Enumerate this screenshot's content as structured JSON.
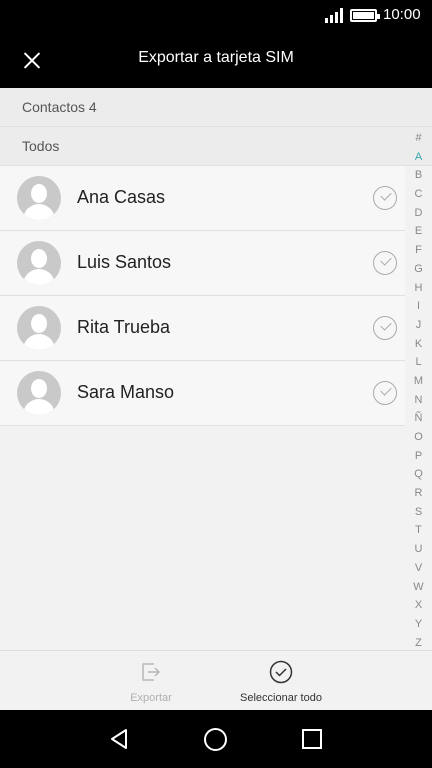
{
  "status_bar": {
    "time": "10:00",
    "icons": [
      "signal-icon",
      "battery-icon"
    ]
  },
  "toolbar": {
    "title": "Exportar a tarjeta SIM",
    "close_icon": "close-icon"
  },
  "header_count": "Contactos 4",
  "header_group": "Todos",
  "contacts": [
    {
      "name": "Ana Casas"
    },
    {
      "name": "Luis Santos"
    },
    {
      "name": "Rita Trueba"
    },
    {
      "name": "Sara Manso"
    }
  ],
  "alphabet": [
    "#",
    "A",
    "B",
    "C",
    "D",
    "E",
    "F",
    "G",
    "H",
    "I",
    "J",
    "K",
    "L",
    "M",
    "N",
    "Ñ",
    "O",
    "P",
    "Q",
    "R",
    "S",
    "T",
    "U",
    "V",
    "W",
    "X",
    "Y",
    "Z"
  ],
  "alphabet_active": "A",
  "actions": {
    "export_label": "Exportar",
    "select_all_label": "Seleccionar todo"
  },
  "colors": {
    "accent": "#3aa7ad",
    "bar": "#000000",
    "background": "#f2f2f2"
  }
}
